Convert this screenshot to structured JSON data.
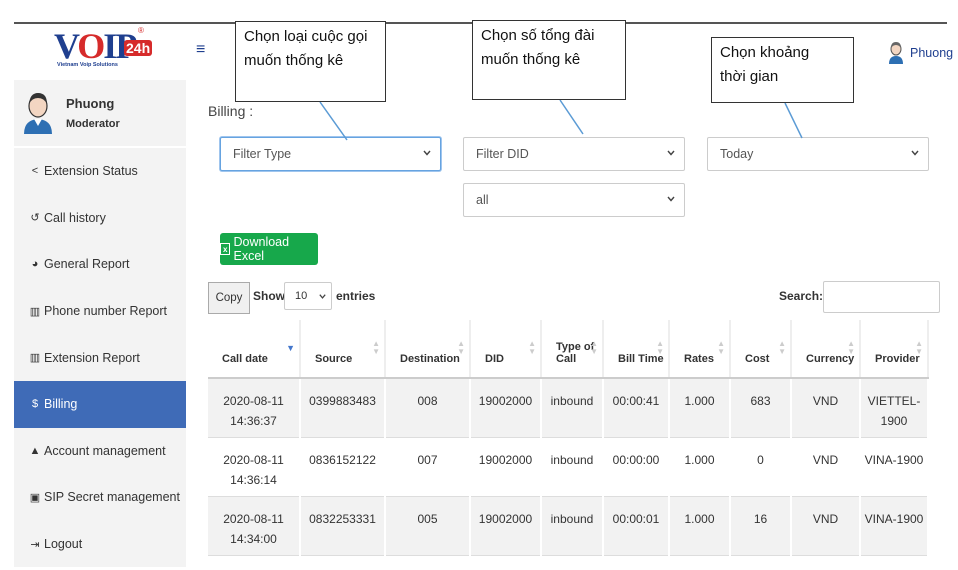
{
  "brand": {
    "name_main": "VOIP",
    "name_suffix": "24h",
    "tagline": "Vietnam Voip Solutions",
    "reg": "®"
  },
  "profile": {
    "name": "Phuong",
    "role": "Moderator"
  },
  "top_user": {
    "name": "Phuong"
  },
  "menu": [
    {
      "label": "Extension Status",
      "icon": "share-icon",
      "glyph": "<"
    },
    {
      "label": "Call history",
      "icon": "history-icon",
      "glyph": "↺"
    },
    {
      "label": "General Report",
      "icon": "pie-chart-icon",
      "glyph": "◕"
    },
    {
      "label": "Phone number Report",
      "icon": "bar-chart-icon",
      "glyph": "▥"
    },
    {
      "label": "Extension Report",
      "icon": "bar-chart-icon",
      "glyph": "▥"
    },
    {
      "label": "Billing",
      "icon": "dollar-icon",
      "glyph": "$",
      "active": true
    },
    {
      "label": "Account management",
      "icon": "user-icon",
      "glyph": "▲"
    },
    {
      "label": "SIP Secret management",
      "icon": "lock-icon",
      "glyph": "▣"
    },
    {
      "label": "Logout",
      "icon": "logout-icon",
      "glyph": "⇥"
    }
  ],
  "page": {
    "title": "Billing :"
  },
  "filters": {
    "type": "Filter Type",
    "did": "Filter DID",
    "did_sub": "all",
    "time": "Today"
  },
  "callouts": {
    "type": "Chọn loại cuộc gọi muốn thống kê",
    "did": "Chọn số tổng đài muốn thống kê",
    "time": "Chọn khoảng thời gian"
  },
  "toolbar": {
    "excel_label": "Download Excel",
    "copy_label": "Copy",
    "show_label": "Show",
    "entries_value": "10",
    "entries_label": "entries",
    "search_label": "Search:"
  },
  "table": {
    "columns": [
      "Call date",
      "Source",
      "Destination",
      "DID",
      "Type of Call",
      "Bill Time",
      "Rates",
      "Cost",
      "Currency",
      "Provider"
    ],
    "rows": [
      [
        "2020-08-11 14:36:37",
        "0399883483",
        "008",
        "19002000",
        "inbound",
        "00:00:41",
        "1.000",
        "683",
        "VND",
        "VIETTEL-1900"
      ],
      [
        "2020-08-11 14:36:14",
        "0836152122",
        "007",
        "19002000",
        "inbound",
        "00:00:00",
        "1.000",
        "0",
        "VND",
        "VINA-1900"
      ],
      [
        "2020-08-11 14:34:00",
        "0832253331",
        "005",
        "19002000",
        "inbound",
        "00:00:01",
        "1.000",
        "16",
        "VND",
        "VINA-1900"
      ]
    ]
  },
  "colors": {
    "accent": "#3f6bb7",
    "excel": "#17a84b",
    "brand_blue": "#1f3f8f",
    "brand_red": "#d62b2b"
  }
}
